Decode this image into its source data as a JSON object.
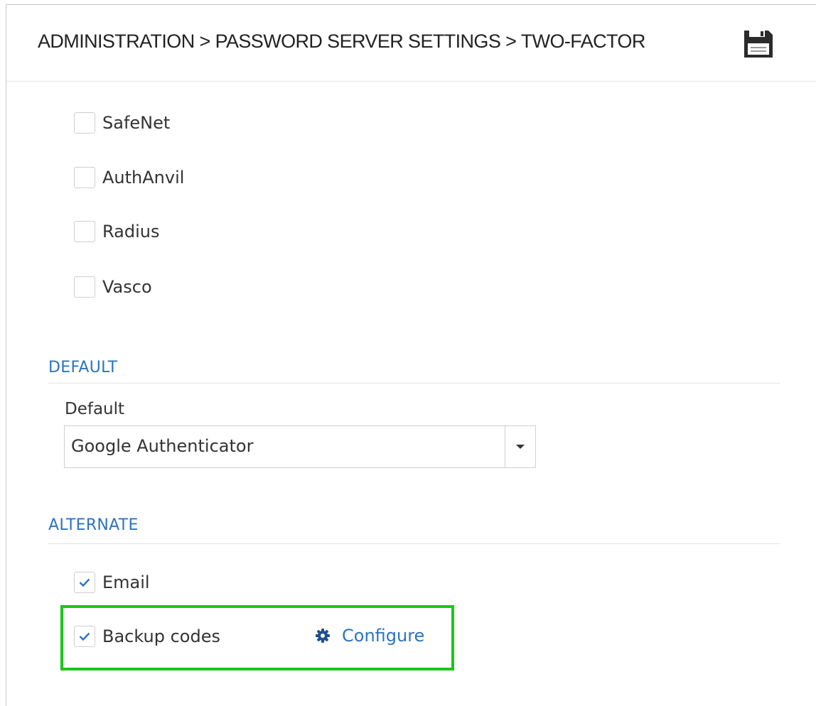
{
  "header": {
    "breadcrumb": "ADMINISTRATION > PASSWORD SERVER SETTINGS > TWO-FACTOR",
    "save_icon": "save-icon"
  },
  "providers": {
    "items": [
      {
        "label": "SafeNet",
        "checked": false
      },
      {
        "label": "AuthAnvil",
        "checked": false
      },
      {
        "label": "Radius",
        "checked": false
      },
      {
        "label": "Vasco",
        "checked": false
      }
    ]
  },
  "default_section": {
    "title": "DEFAULT",
    "field_label": "Default",
    "selected_value": "Google Authenticator",
    "dropdown_icon": "caret-down-icon"
  },
  "alternate_section": {
    "title": "ALTERNATE",
    "items": [
      {
        "label": "Email",
        "checked": true
      },
      {
        "label": "Backup codes",
        "checked": true
      }
    ],
    "configure_label": "Configure",
    "configure_icon": "gear-icon"
  },
  "colors": {
    "accent": "#2d73c0",
    "highlight_border": "#19c819",
    "text": "#333333"
  }
}
